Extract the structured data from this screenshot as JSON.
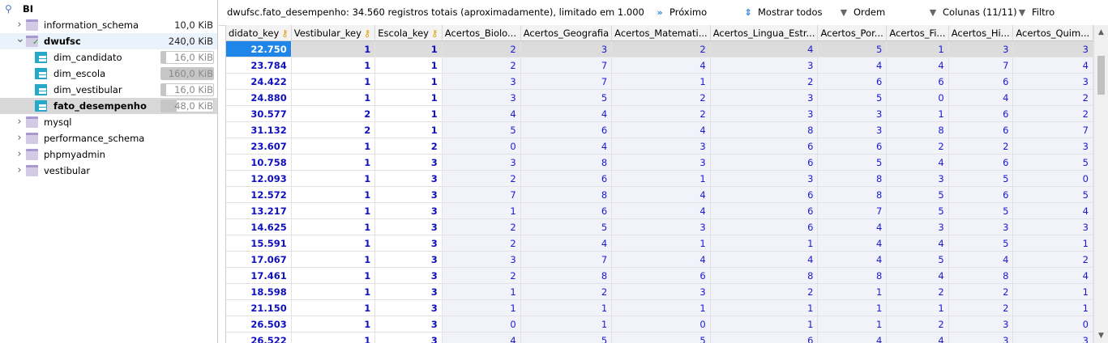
{
  "tree": {
    "root": {
      "label": "BI"
    },
    "items": [
      {
        "label": "information_schema",
        "size": "10,0 KiB",
        "type": "db",
        "expanded": false
      },
      {
        "label": "dwufsc",
        "size": "240,0 KiB",
        "type": "db",
        "expanded": true
      },
      {
        "label": "dim_candidato",
        "size": "16,0 KiB",
        "type": "table",
        "fill": 0.1
      },
      {
        "label": "dim_escola",
        "size": "160,0 KiB",
        "type": "table",
        "fill": 1.0
      },
      {
        "label": "dim_vestibular",
        "size": "16,0 KiB",
        "type": "table",
        "fill": 0.1
      },
      {
        "label": "fato_desempenho",
        "size": "48,0 KiB",
        "type": "table",
        "fill": 0.3
      },
      {
        "label": "mysql",
        "type": "db",
        "expanded": false
      },
      {
        "label": "performance_schema",
        "type": "db",
        "expanded": false
      },
      {
        "label": "phpmyadmin",
        "type": "db",
        "expanded": false
      },
      {
        "label": "vestibular",
        "type": "db",
        "expanded": false
      }
    ]
  },
  "toolbar": {
    "info": "dwufsc.fato_desempenho: 34.560 registros totais (aproximadamente), limitado em 1.000",
    "next": "Próximo",
    "show_all": "Mostrar todos",
    "order": "Ordem",
    "columns": "Colunas (11/11)",
    "filter": "Filtro"
  },
  "grid": {
    "columns": [
      {
        "label": "didato_key",
        "key": true
      },
      {
        "label": "Vestibular_key",
        "key": true
      },
      {
        "label": "Escola_key",
        "key": true
      },
      {
        "label": "Acertos_Biolo...",
        "key": false
      },
      {
        "label": "Acertos_Geografia",
        "key": false
      },
      {
        "label": "Acertos_Matemati...",
        "key": false
      },
      {
        "label": "Acertos_Lingua_Estr...",
        "key": false
      },
      {
        "label": "Acertos_Por...",
        "key": false
      },
      {
        "label": "Acertos_Fi...",
        "key": false
      },
      {
        "label": "Acertos_Hi...",
        "key": false
      },
      {
        "label": "Acertos_Quim...",
        "key": false
      }
    ],
    "rows": [
      [
        "22.750",
        "1",
        "1",
        "2",
        "3",
        "2",
        "4",
        "5",
        "1",
        "3",
        "3"
      ],
      [
        "23.784",
        "1",
        "1",
        "2",
        "7",
        "4",
        "3",
        "4",
        "4",
        "7",
        "4"
      ],
      [
        "24.422",
        "1",
        "1",
        "3",
        "7",
        "1",
        "2",
        "6",
        "6",
        "6",
        "3"
      ],
      [
        "24.880",
        "1",
        "1",
        "3",
        "5",
        "2",
        "3",
        "5",
        "0",
        "4",
        "2"
      ],
      [
        "30.577",
        "2",
        "1",
        "4",
        "4",
        "2",
        "3",
        "3",
        "1",
        "6",
        "2"
      ],
      [
        "31.132",
        "2",
        "1",
        "5",
        "6",
        "4",
        "8",
        "3",
        "8",
        "6",
        "7"
      ],
      [
        "23.607",
        "1",
        "2",
        "0",
        "4",
        "3",
        "6",
        "6",
        "2",
        "2",
        "3"
      ],
      [
        "10.758",
        "1",
        "3",
        "3",
        "8",
        "3",
        "6",
        "5",
        "4",
        "6",
        "5"
      ],
      [
        "12.093",
        "1",
        "3",
        "2",
        "6",
        "1",
        "3",
        "8",
        "3",
        "5",
        "0"
      ],
      [
        "12.572",
        "1",
        "3",
        "7",
        "8",
        "4",
        "6",
        "8",
        "5",
        "6",
        "5"
      ],
      [
        "13.217",
        "1",
        "3",
        "1",
        "6",
        "4",
        "6",
        "7",
        "5",
        "5",
        "4"
      ],
      [
        "14.625",
        "1",
        "3",
        "2",
        "5",
        "3",
        "6",
        "4",
        "3",
        "3",
        "3"
      ],
      [
        "15.591",
        "1",
        "3",
        "2",
        "4",
        "1",
        "1",
        "4",
        "4",
        "5",
        "1"
      ],
      [
        "17.067",
        "1",
        "3",
        "3",
        "7",
        "4",
        "4",
        "4",
        "5",
        "4",
        "2"
      ],
      [
        "17.461",
        "1",
        "3",
        "2",
        "8",
        "6",
        "8",
        "8",
        "4",
        "8",
        "4"
      ],
      [
        "18.598",
        "1",
        "3",
        "1",
        "2",
        "3",
        "2",
        "1",
        "2",
        "2",
        "1"
      ],
      [
        "21.150",
        "1",
        "3",
        "1",
        "1",
        "1",
        "1",
        "1",
        "1",
        "2",
        "1"
      ],
      [
        "26.503",
        "1",
        "3",
        "0",
        "1",
        "0",
        "1",
        "1",
        "2",
        "3",
        "0"
      ],
      [
        "26.522",
        "1",
        "3",
        "4",
        "5",
        "5",
        "6",
        "4",
        "4",
        "3",
        "3"
      ]
    ]
  }
}
